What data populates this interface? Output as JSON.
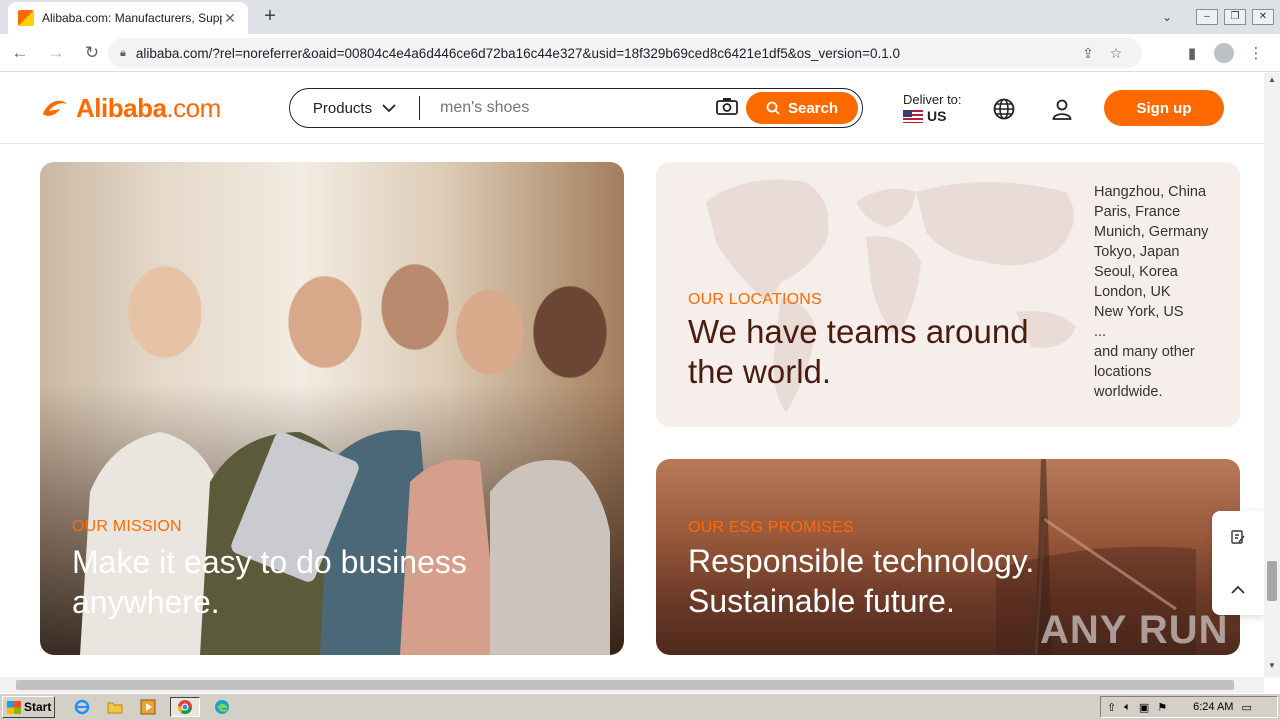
{
  "browser": {
    "tab_title": "Alibaba.com: Manufacturers, Suppliers, Exporters & Importers",
    "tab_close": "✕",
    "new_tab": "+",
    "url": "alibaba.com/?rel=noreferrer&oaid=00804c4e4a6d446ce6d72ba16c44e327&usid=18f329b69ced8c6421e1df5&os_version=0.1.0"
  },
  "header": {
    "logo_brand": "Alibaba",
    "logo_suffix": ".com",
    "search_category": "Products",
    "search_placeholder": "men's shoes",
    "search_button": "Search",
    "deliver_label": "Deliver to:",
    "deliver_country": "US",
    "signup": "Sign up"
  },
  "mission": {
    "label": "OUR MISSION",
    "headline_1": "Make it easy to do business",
    "headline_2": "anywhere."
  },
  "locations": {
    "label": "OUR LOCATIONS",
    "headline_1": "We have teams around",
    "headline_2": "the world.",
    "cities": [
      "Hangzhou, China",
      "Paris, France",
      "Munich, Germany",
      "Tokyo, Japan",
      "Seoul, Korea",
      "London, UK",
      "New York, US",
      "...",
      "and many other",
      "locations",
      "worldwide."
    ]
  },
  "esg": {
    "label": "OUR ESG PROMISES",
    "headline_1": "Responsible technology.",
    "headline_2": "Sustainable future."
  },
  "watermark": "ANY RUN",
  "taskbar": {
    "start": "Start",
    "clock": "6:24 AM"
  },
  "colors": {
    "accent": "#ff6a00",
    "location_text": "#4a1c10"
  }
}
